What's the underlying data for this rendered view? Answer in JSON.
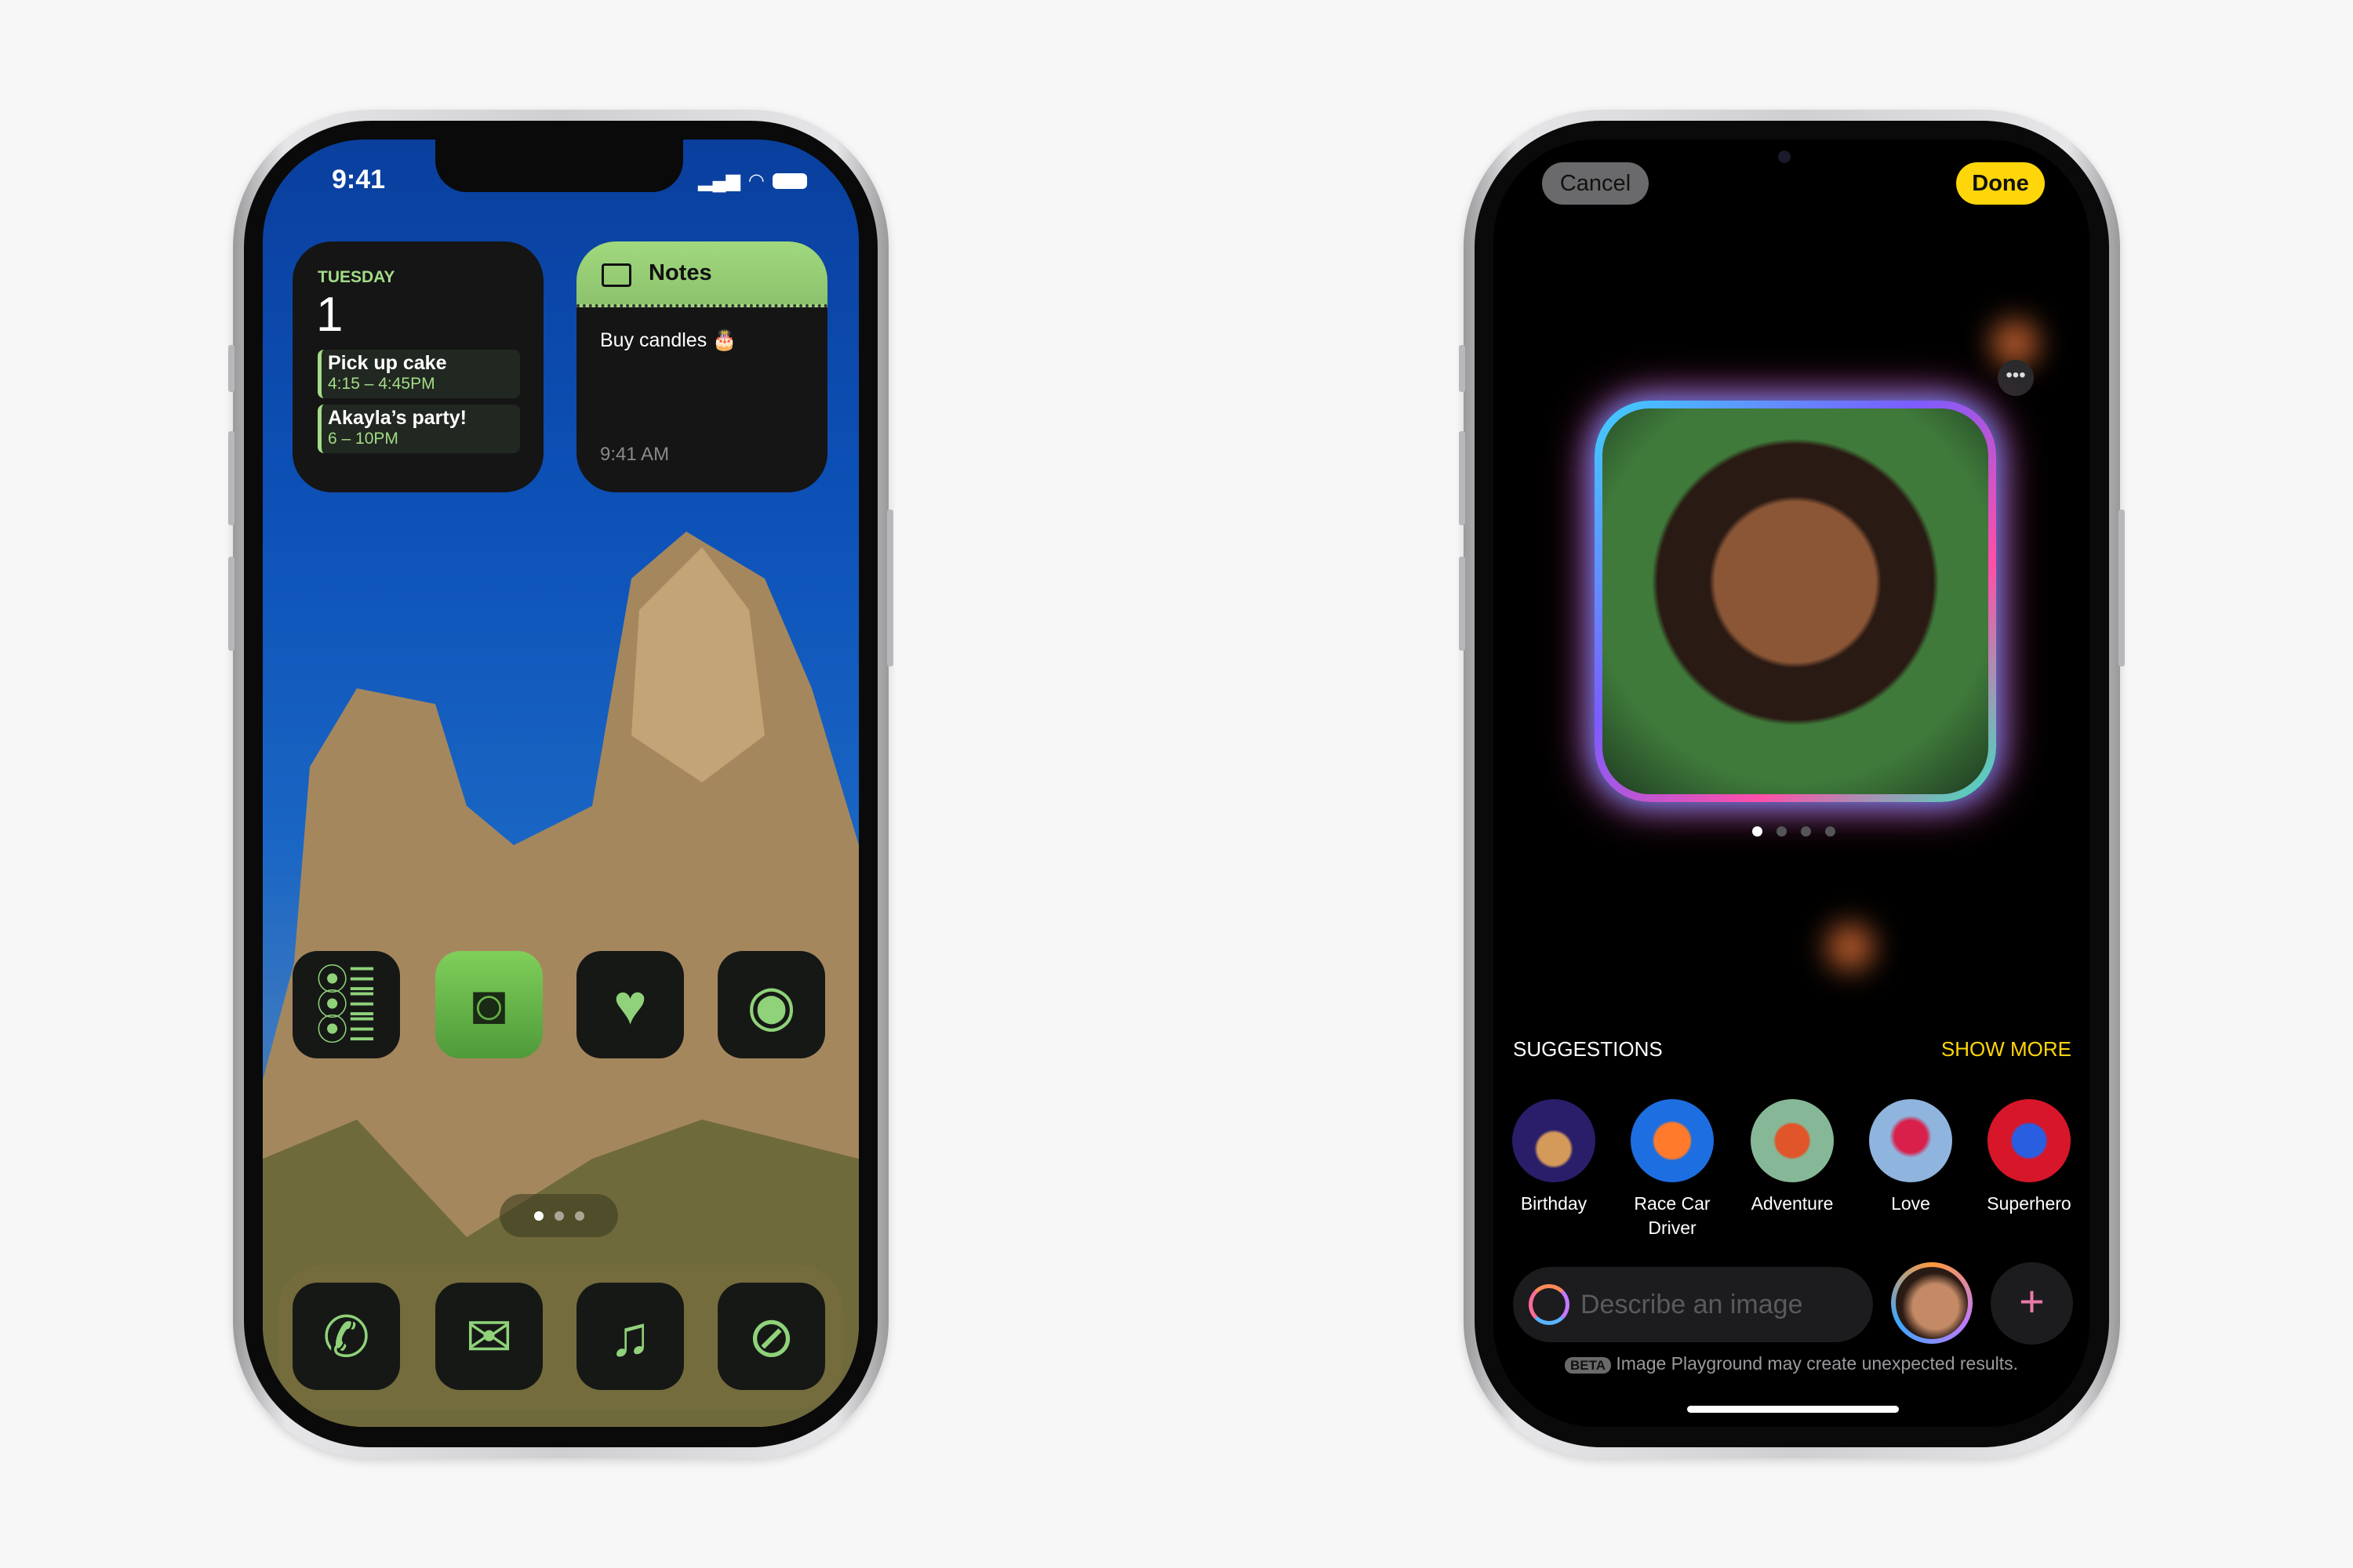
{
  "home_screen": {
    "status_bar": {
      "time": "9:41"
    },
    "calendar_widget": {
      "day": "TUESDAY",
      "date": "1",
      "events": [
        {
          "title": "Pick up cake",
          "time": "4:15 – 4:45PM"
        },
        {
          "title": "Akayla’s party!",
          "time": "6 – 10PM"
        }
      ]
    },
    "notes_widget": {
      "title": "Notes",
      "note": "Buy candles 🎂",
      "timestamp": "9:41 AM"
    },
    "apps": [
      "reminders-icon",
      "camera-icon",
      "health-icon",
      "contacts-icon"
    ],
    "dock": [
      "phone-icon",
      "mail-icon",
      "music-icon",
      "compass-icon"
    ],
    "page_count": 3,
    "current_page": 1,
    "accent": "#8fd27a"
  },
  "image_playground": {
    "cancel_label": "Cancel",
    "done_label": "Done",
    "image_page_count": 4,
    "current_image": 1,
    "suggestions_label": "SUGGESTIONS",
    "show_more_label": "SHOW MORE",
    "suggestions": [
      {
        "label": "Birthday"
      },
      {
        "label": "Race Car Driver"
      },
      {
        "label": "Adventure"
      },
      {
        "label": "Love"
      },
      {
        "label": "Superhero"
      }
    ],
    "input_placeholder": "Describe an image",
    "beta_badge": "BETA",
    "disclaimer": "Image Playground may create unexpected results.",
    "accent": "#ffd60a"
  }
}
